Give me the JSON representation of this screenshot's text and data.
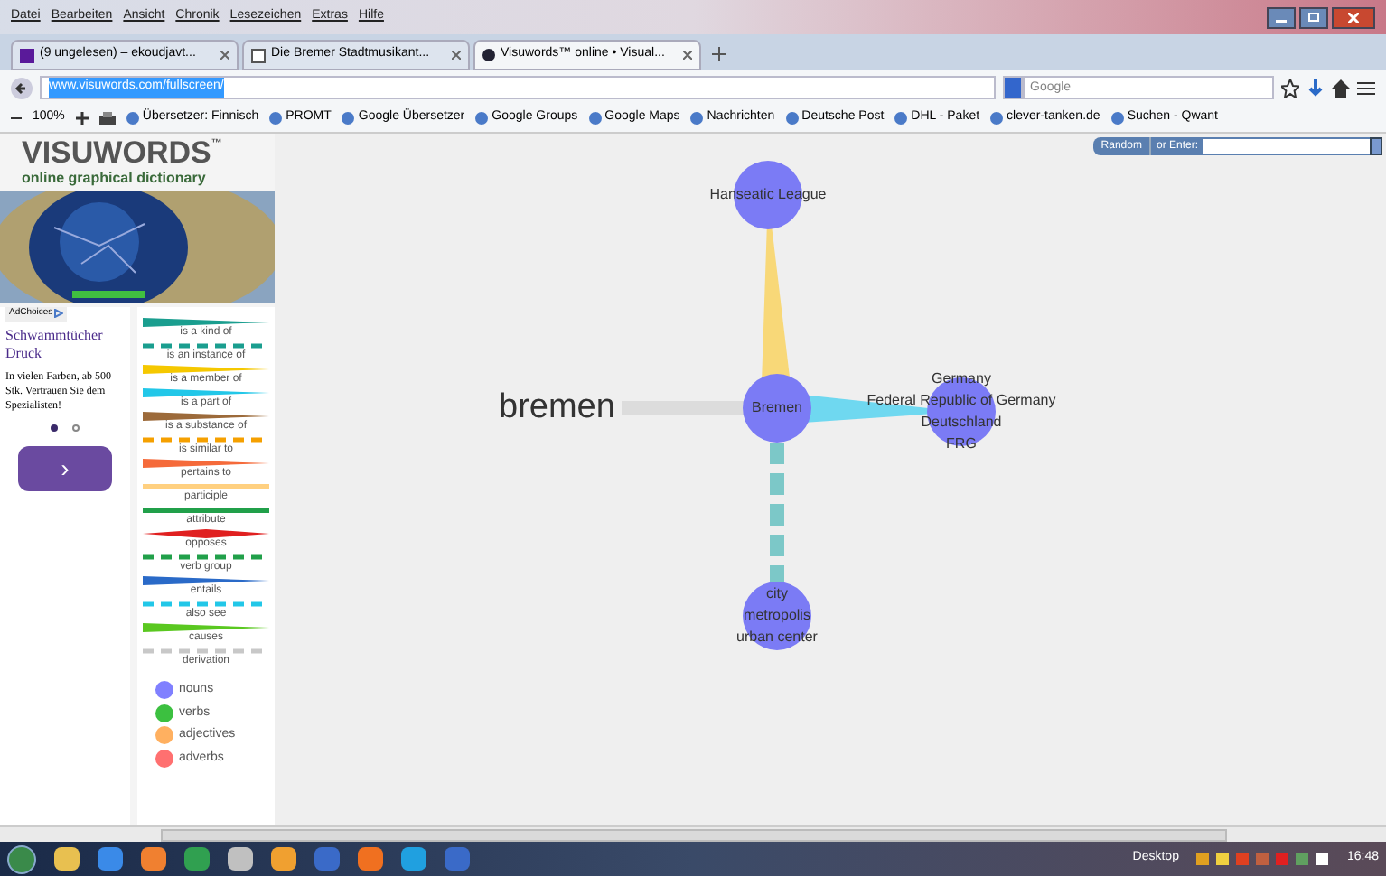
{
  "menu": [
    "Datei",
    "Bearbeiten",
    "Ansicht",
    "Chronik",
    "Lesezeichen",
    "Extras",
    "Hilfe"
  ],
  "tabs": [
    {
      "label": "(9 ungelesen) – ekoudjavt...",
      "selected": false,
      "kind": "mail"
    },
    {
      "label": "Die Bremer Stadtmusikant...",
      "selected": false,
      "kind": "wiki"
    },
    {
      "label": "Visuwords™ online • Visual...",
      "selected": true,
      "kind": "site"
    }
  ],
  "address": {
    "value": "www.visuwords.com/fullscreen/"
  },
  "search": {
    "placeholder": "Google"
  },
  "zoom": "100%",
  "bookmarks": [
    "Übersetzer: Finnisch",
    "PROMT",
    "Google Übersetzer",
    "Google Groups",
    "Google Maps",
    "Nachrichten",
    "Deutsche Post",
    "DHL - Paket",
    "clever-tanken.de",
    "Suchen - Qwant"
  ],
  "sidebar": {
    "logo": "VISUWORDS",
    "trademark": "™",
    "tagline": "online graphical dictionary",
    "ad": {
      "choices": "AdChoices",
      "title": "Schwammtücher Druck",
      "body": "In vielen Farben, ab 500 Stk. Vertrauen Sie dem Spezialisten!",
      "dots": [
        {
          "selected": true
        },
        {
          "selected": false
        }
      ],
      "next": "›"
    },
    "legend": [
      {
        "label": "is a kind of",
        "kind": "taper",
        "color": "#1a9e8f"
      },
      {
        "label": "is an instance of",
        "kind": "dashed",
        "color": "#1a9e8f"
      },
      {
        "label": "is a member of",
        "kind": "taper",
        "color": "#f5c800"
      },
      {
        "label": "is a part of",
        "kind": "taper",
        "color": "#22c7e8"
      },
      {
        "label": "is a substance of",
        "kind": "taper",
        "color": "#9c6a3a"
      },
      {
        "label": "is similar to",
        "kind": "dashed",
        "color": "#f5a000"
      },
      {
        "label": "pertains to",
        "kind": "taper",
        "color": "#f56a3a"
      },
      {
        "label": "participle",
        "kind": "bar",
        "color": "#ffd080"
      },
      {
        "label": "attribute",
        "kind": "bar",
        "color": "#21a04a"
      },
      {
        "label": "opposes",
        "kind": "double",
        "color": "#e02020"
      },
      {
        "label": "verb group",
        "kind": "dashed",
        "color": "#21a04a"
      },
      {
        "label": "entails",
        "kind": "taper",
        "color": "#2a6ac8"
      },
      {
        "label": "also see",
        "kind": "dashed",
        "color": "#22c7e8"
      },
      {
        "label": "causes",
        "kind": "taper",
        "color": "#5ac820"
      },
      {
        "label": "derivation",
        "kind": "dashed",
        "color": "#c8c8c8"
      }
    ],
    "parts_of_speech": [
      {
        "label": "nouns",
        "color": "#8080ff"
      },
      {
        "label": "verbs",
        "color": "#3cc040"
      },
      {
        "label": "adjectives",
        "color": "#ffb060"
      },
      {
        "label": "adverbs",
        "color": "#ff7070"
      }
    ]
  },
  "lookup": {
    "random": "Random",
    "prompt": "or Enter:"
  },
  "graph": {
    "word": "bremen",
    "nodes": [
      {
        "labels": [
          "Hanseatic League"
        ],
        "color": "#7b7bf5"
      },
      {
        "labels": [
          "Bremen"
        ],
        "color": "#7b7bf5"
      },
      {
        "labels": [
          "Germany",
          "Federal Republic of Germany",
          "Deutschland",
          "FRG"
        ],
        "color": "#7b7bf5"
      },
      {
        "labels": [
          "city",
          "metropolis",
          "urban center"
        ],
        "color": "#7b7bf5"
      }
    ],
    "edges": [
      {
        "kind": "taper",
        "color": "#f8d878"
      },
      {
        "kind": "taper",
        "color": "#6fd8f0"
      },
      {
        "kind": "dashed",
        "color": "#7cc8c8"
      }
    ]
  },
  "taskbar": {
    "desktop": "Desktop",
    "time": "16:48"
  }
}
